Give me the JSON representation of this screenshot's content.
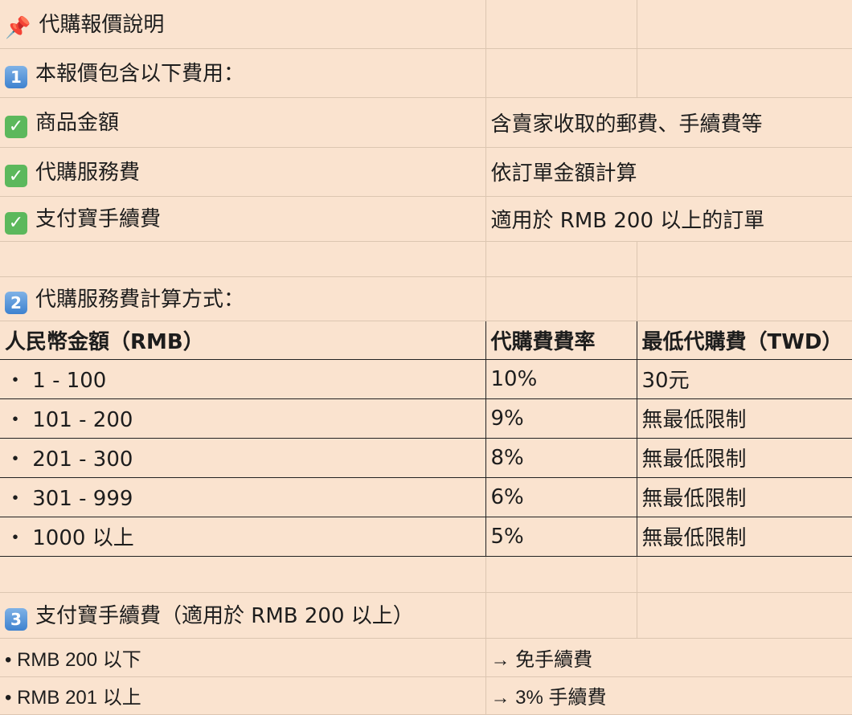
{
  "title": {
    "icon": "pushpin-icon",
    "text": "代購報價說明"
  },
  "section1": {
    "badge": "1",
    "text": "本報價包含以下費用："
  },
  "fees": [
    {
      "check": "✓",
      "name": "商品金額",
      "note": "含賣家收取的郵費、手續費等"
    },
    {
      "check": "✓",
      "name": "代購服務費",
      "note": "依訂單金額計算"
    },
    {
      "check": "✓",
      "name": "支付寶手續費",
      "note": "適用於 RMB 200 以上的訂單"
    }
  ],
  "section2": {
    "badge": "2",
    "text": "代購服務費計算方式："
  },
  "rate_table": {
    "headers": [
      "人民幣金額（RMB）",
      "代購費費率",
      "最低代購費（TWD）"
    ],
    "rows": [
      {
        "range": "・ 1 - 100",
        "rate": "10%",
        "min": "30元"
      },
      {
        "range": "・ 101 - 200",
        "rate": "9%",
        "min": "無最低限制"
      },
      {
        "range": "・ 201 - 300",
        "rate": "8%",
        "min": "無最低限制"
      },
      {
        "range": "・ 301 - 999",
        "rate": "6%",
        "min": "無最低限制"
      },
      {
        "range": "・ 1000 以上",
        "rate": "5%",
        "min": "無最低限制"
      }
    ]
  },
  "section3": {
    "badge": "3",
    "text": "支付寶手續費（適用於 RMB 200 以上）"
  },
  "alipay": [
    {
      "condition": "• RMB 200 以下",
      "result": "→ 免手續費"
    },
    {
      "condition": "• RMB 201 以上",
      "result": "→ 3% 手續費"
    }
  ]
}
